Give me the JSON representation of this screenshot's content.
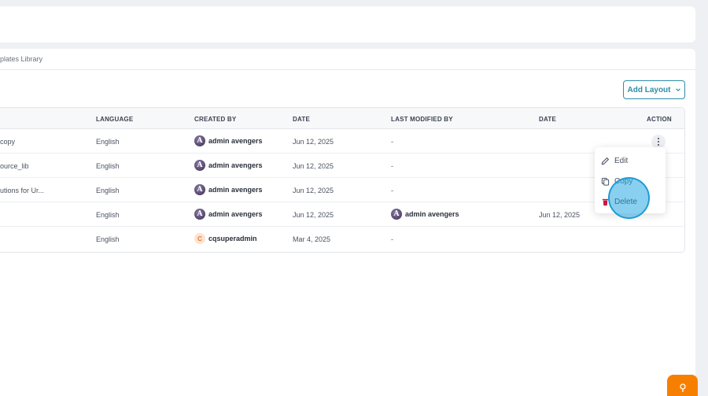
{
  "breadcrumb": "plates Library",
  "add_layout_label": "Add Layout",
  "table": {
    "headers": {
      "language": "LANGUAGE",
      "created_by": "CREATED BY",
      "date": "DATE",
      "last_modified_by": "LAST MODIFIED BY",
      "date2": "DATE",
      "action": "ACTION"
    },
    "rows": [
      {
        "name": "copy",
        "language": "English",
        "created_by": "admin avengers",
        "created_avatar": "avengers-logo",
        "date": "Jun 12, 2025",
        "last_modified_by": "-",
        "modified_date": ""
      },
      {
        "name": "ource_lib",
        "language": "English",
        "created_by": "admin avengers",
        "created_avatar": "avengers-logo",
        "date": "Jun 12, 2025",
        "last_modified_by": "-",
        "modified_date": ""
      },
      {
        "name": "utions for Ur...",
        "language": "English",
        "created_by": "admin avengers",
        "created_avatar": "avengers-logo",
        "date": "Jun 12, 2025",
        "last_modified_by": "-",
        "modified_date": ""
      },
      {
        "name": "",
        "language": "English",
        "created_by": "admin avengers",
        "created_avatar": "avengers-logo",
        "date": "Jun 12, 2025",
        "last_modified_by": "admin avengers",
        "modified_avatar": "avengers-logo",
        "modified_date": "Jun 12, 2025"
      },
      {
        "name": "",
        "language": "English",
        "created_by": "cqsuperadmin",
        "created_avatar_letter": "C",
        "date": "Mar 4, 2025",
        "last_modified_by": "-",
        "modified_date": ""
      }
    ]
  },
  "avatar_logo_letter": "A",
  "context_menu": {
    "edit": "Edit",
    "copy": "Copy",
    "delete": "Delete"
  },
  "colors": {
    "accent": "#2d8ea8",
    "help_button": "#f77f00",
    "delete_icon": "#d0143c",
    "highlight": "#28a8e2"
  },
  "icons": [
    "chevron-down-icon",
    "kebab-menu-icon",
    "pencil-icon",
    "copy-icon",
    "trash-icon",
    "help-icon"
  ]
}
